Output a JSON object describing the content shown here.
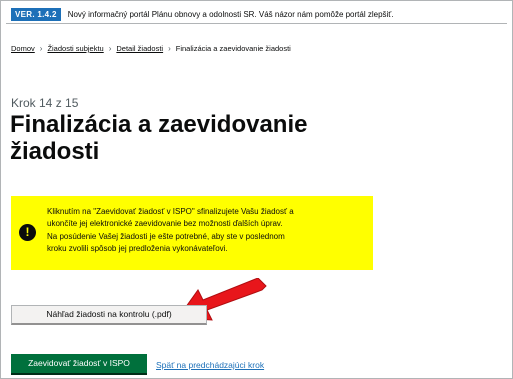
{
  "phase_banner": {
    "tag": "VER. 1.4.2",
    "text": "Nový informačný portál Plánu obnovy a odolnosti SR. Váš názor nám pomôže portál zlepšiť."
  },
  "breadcrumb": {
    "items": [
      "Domov",
      "Žiadosti subjektu",
      "Detail žiadosti"
    ],
    "current": "Finalizácia a zaevidovanie žiadosti"
  },
  "step": {
    "caption": "Krok 14 z 15",
    "title_line1": "Finalizácia a zaevidovanie",
    "title_line2": "žiadosti"
  },
  "warning": {
    "icon": "!",
    "lines": [
      "Kliknutím na \"Zaevidovať žiadosť v ISPO\" sfinalizujete Vašu žiadosť a",
      "ukončíte jej elektronické zaevidovanie bez možnosti ďalších úprav.",
      "Na posúdenie Vašej žiadosti je ešte potrebné, aby ste v poslednom",
      "kroku zvolili spôsob jej predloženia vykonávateľovi."
    ]
  },
  "buttons": {
    "preview": "Náhľad žiadosti na kontrolu (.pdf)",
    "submit": "Zaevidovať žiadosť v ISPO",
    "back": "Späť na predchádzajúci krok"
  },
  "colors": {
    "tag": "#1d70b8",
    "warning_bg": "#ffff00",
    "primary": "#00703c",
    "arrow": "#e8161b",
    "link": "#1d70b8"
  }
}
